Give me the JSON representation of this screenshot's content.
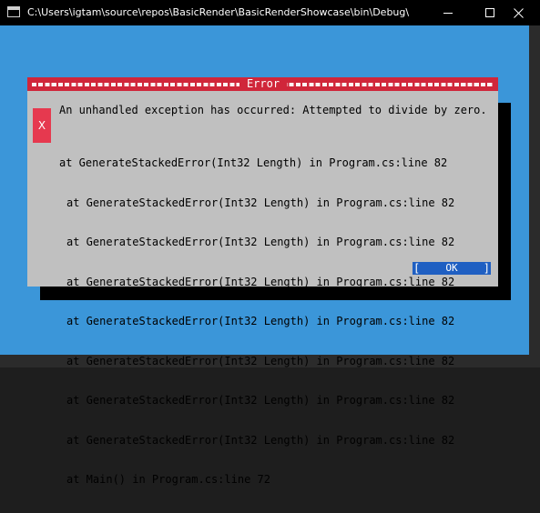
{
  "window": {
    "title": "C:\\Users\\igtam\\source\\repos\\BasicRender\\BasicRenderShowcase\\bin\\Debug\\BasicRender..."
  },
  "dialog": {
    "title": "Error",
    "icon_label": "X",
    "message": "An unhandled exception has occurred: Attempted to divide by zero.",
    "stack_trace": [
      "at GenerateStackedError(Int32 Length) in Program.cs:line 82",
      "at GenerateStackedError(Int32 Length) in Program.cs:line 82",
      "at GenerateStackedError(Int32 Length) in Program.cs:line 82",
      "at GenerateStackedError(Int32 Length) in Program.cs:line 82",
      "at GenerateStackedError(Int32 Length) in Program.cs:line 82",
      "at GenerateStackedError(Int32 Length) in Program.cs:line 82",
      "at GenerateStackedError(Int32 Length) in Program.cs:line 82",
      "at GenerateStackedError(Int32 Length) in Program.cs:line 82",
      "at Main() in Program.cs:line 72"
    ],
    "ok_label": "OK"
  },
  "colors": {
    "console_background": "#3b96d9",
    "dialog_background": "#c0c0c0",
    "header_red": "#d0263a",
    "icon_red": "#e6394f",
    "button_blue": "#1f5fc2"
  },
  "icons": {
    "app": "console-window-icon",
    "minimize": "minimize-icon",
    "maximize": "maximize-icon",
    "close": "close-icon"
  }
}
